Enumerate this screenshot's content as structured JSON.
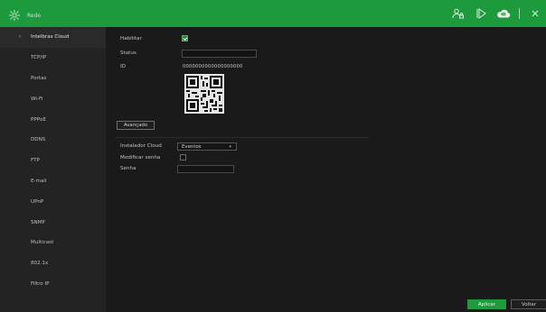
{
  "topbar": {
    "title": "Rede",
    "icons": [
      "network-icon",
      "user-lock-icon",
      "playback-icon",
      "cloud-icon",
      "close-icon"
    ],
    "cloud_badge": "Cloud",
    "accent": "#1d9b3c"
  },
  "sidebar": {
    "items": [
      {
        "label": "Intelbras Cloud",
        "active": true
      },
      {
        "label": "TCP/IP"
      },
      {
        "label": "Portas"
      },
      {
        "label": "Wi-Fi"
      },
      {
        "label": "PPPoE"
      },
      {
        "label": "DDNS"
      },
      {
        "label": "FTP"
      },
      {
        "label": "E-mail"
      },
      {
        "label": "UPnP"
      },
      {
        "label": "SNMP"
      },
      {
        "label": "Multicast"
      },
      {
        "label": "802.1x"
      },
      {
        "label": "Filtro IP"
      }
    ]
  },
  "form": {
    "habilitar_label": "Habilitar",
    "habilitar_checked": true,
    "status_label": "Status",
    "status_value": "",
    "id_label": "ID",
    "id_value": "0000000000000000000",
    "avancado_label": "Avançado",
    "instalador_label": "Instalador Cloud",
    "instalador_value": "Eventos",
    "modificar_senha_label": "Modificar senha",
    "modificar_senha_checked": false,
    "senha_label": "Senha",
    "senha_value": ""
  },
  "footer": {
    "aplicar_label": "Aplicar",
    "voltar_label": "Voltar"
  }
}
